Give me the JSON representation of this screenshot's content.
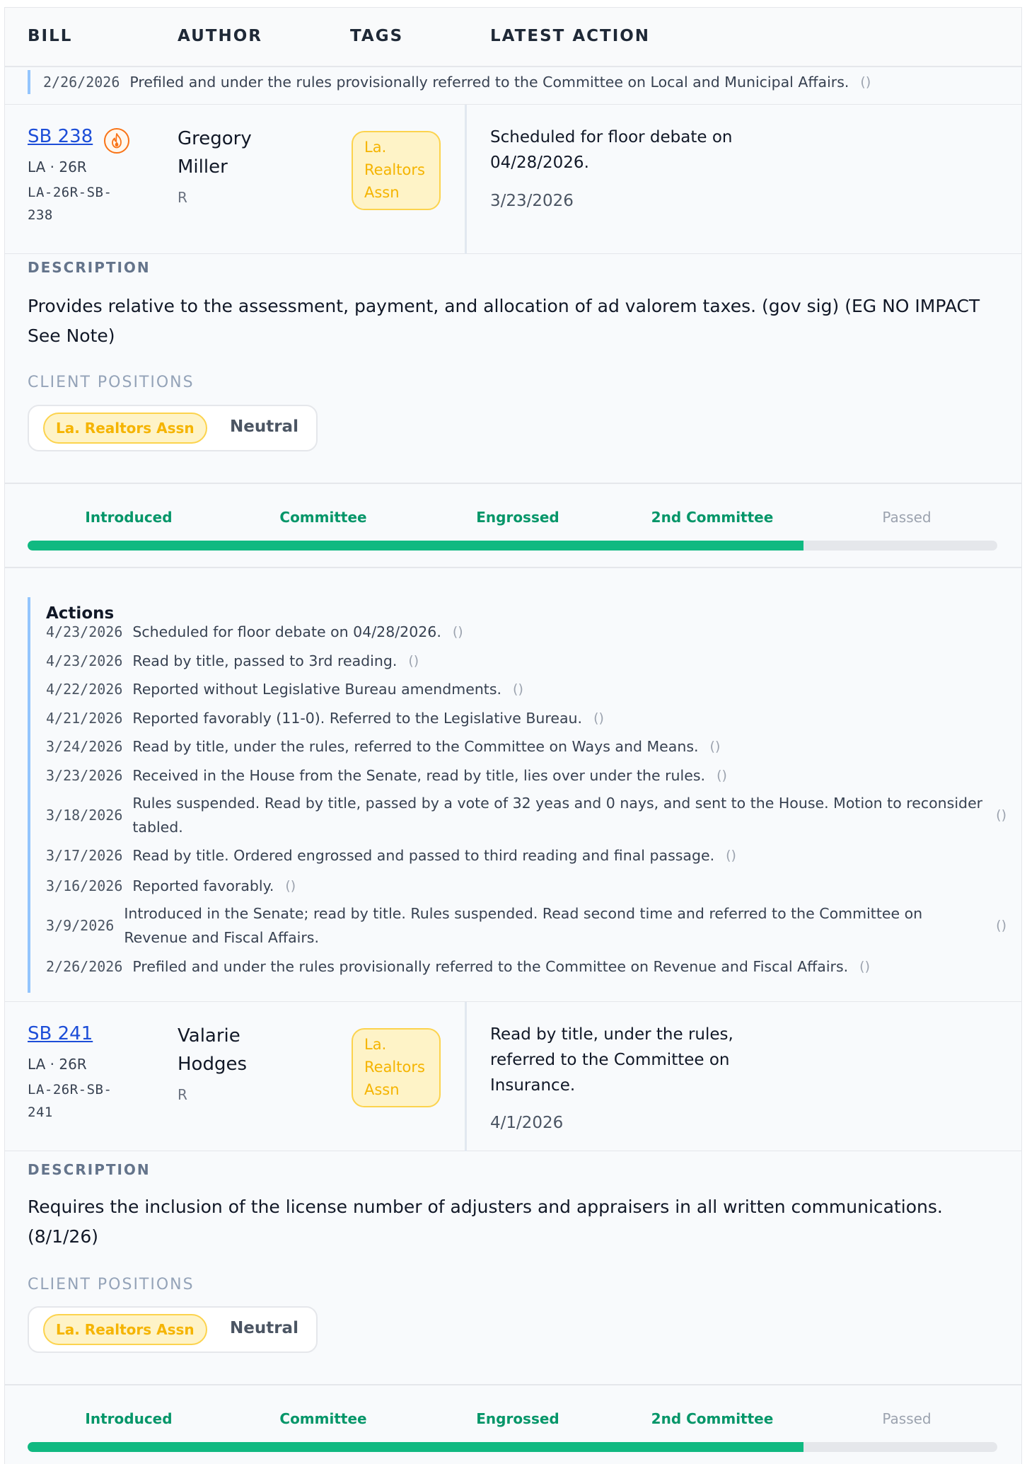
{
  "header": {
    "col_bill": "BILL",
    "col_author": "AUTHOR",
    "col_tags": "TAGS",
    "col_latest": "LATEST ACTION"
  },
  "prev_action": {
    "date": "2/26/2026",
    "text": "Prefiled and under the rules provisionally referred to the Committee on Local and Municipal Affairs.",
    "paren": "()"
  },
  "labels": {
    "description": "DESCRIPTION",
    "client_positions": "CLIENT POSITIONS",
    "actions": "Actions"
  },
  "stages": [
    "Introduced",
    "Committee",
    "Engrossed",
    "2nd Committee",
    "Passed"
  ],
  "bills": [
    {
      "number": "SB 238",
      "hot": true,
      "jurisdiction": "LA · 26R",
      "bill_id": "LA-26R-SB-238",
      "author": "Gregory Miller",
      "party": "R",
      "tag": "La. Realtors Assn",
      "latest_action": "Scheduled for floor debate on 04/28/2026.",
      "latest_date": "3/23/2026",
      "description": "Provides relative to the assessment, payment, and allocation of ad valorem taxes. (gov sig) (EG NO IMPACT See Note)",
      "client_position": {
        "client": "La. Realtors Assn",
        "position": "Neutral"
      },
      "progress_fraction": 0.8,
      "completed_stages": 4,
      "actions": [
        {
          "date": "4/23/2026",
          "text": "Scheduled for floor debate on 04/28/2026.",
          "paren": "()"
        },
        {
          "date": "4/23/2026",
          "text": "Read by title, passed to 3rd reading.",
          "paren": "()"
        },
        {
          "date": "4/22/2026",
          "text": "Reported without Legislative Bureau amendments.",
          "paren": "()"
        },
        {
          "date": "4/21/2026",
          "text": "Reported favorably (11-0). Referred to the Legislative Bureau.",
          "paren": "()"
        },
        {
          "date": "3/24/2026",
          "text": "Read by title, under the rules, referred to the Committee on Ways and Means.",
          "paren": "()"
        },
        {
          "date": "3/23/2026",
          "text": "Received in the House from the Senate, read by title, lies over under the rules.",
          "paren": "()"
        },
        {
          "date": "3/18/2026",
          "text": "Rules suspended. Read by title, passed by a vote of 32 yeas and 0 nays, and sent to the House. Motion to reconsider tabled.",
          "paren": "()"
        },
        {
          "date": "3/17/2026",
          "text": "Read by title. Ordered engrossed and passed to third reading and final passage.",
          "paren": "()"
        },
        {
          "date": "3/16/2026",
          "text": "Reported favorably.",
          "paren": "()"
        },
        {
          "date": "3/9/2026",
          "text": "Introduced in the Senate; read by title. Rules suspended. Read second time and referred to the Committee on Revenue and Fiscal Affairs.",
          "paren": "()"
        },
        {
          "date": "2/26/2026",
          "text": "Prefiled and under the rules provisionally referred to the Committee on Revenue and Fiscal Affairs.",
          "paren": "()"
        }
      ]
    },
    {
      "number": "SB 241",
      "hot": false,
      "jurisdiction": "LA · 26R",
      "bill_id": "LA-26R-SB-241",
      "author": "Valarie Hodges",
      "party": "R",
      "tag": "La. Realtors Assn",
      "latest_action": "Read by title, under the rules, referred to the Committee on Insurance.",
      "latest_date": "4/1/2026",
      "description": "Requires the inclusion of the license number of adjusters and appraisers in all written communications. (8/1/26)",
      "client_position": {
        "client": "La. Realtors Assn",
        "position": "Neutral"
      },
      "progress_fraction": 0.8,
      "completed_stages": 4
    }
  ],
  "colors": {
    "accent_link": "#1d4ed8",
    "progress_done": "#10b981",
    "stage_done_text": "#059669",
    "tag_bg": "#fef3c7",
    "tag_text": "#f5b400",
    "action_rail": "#93c5fd"
  }
}
